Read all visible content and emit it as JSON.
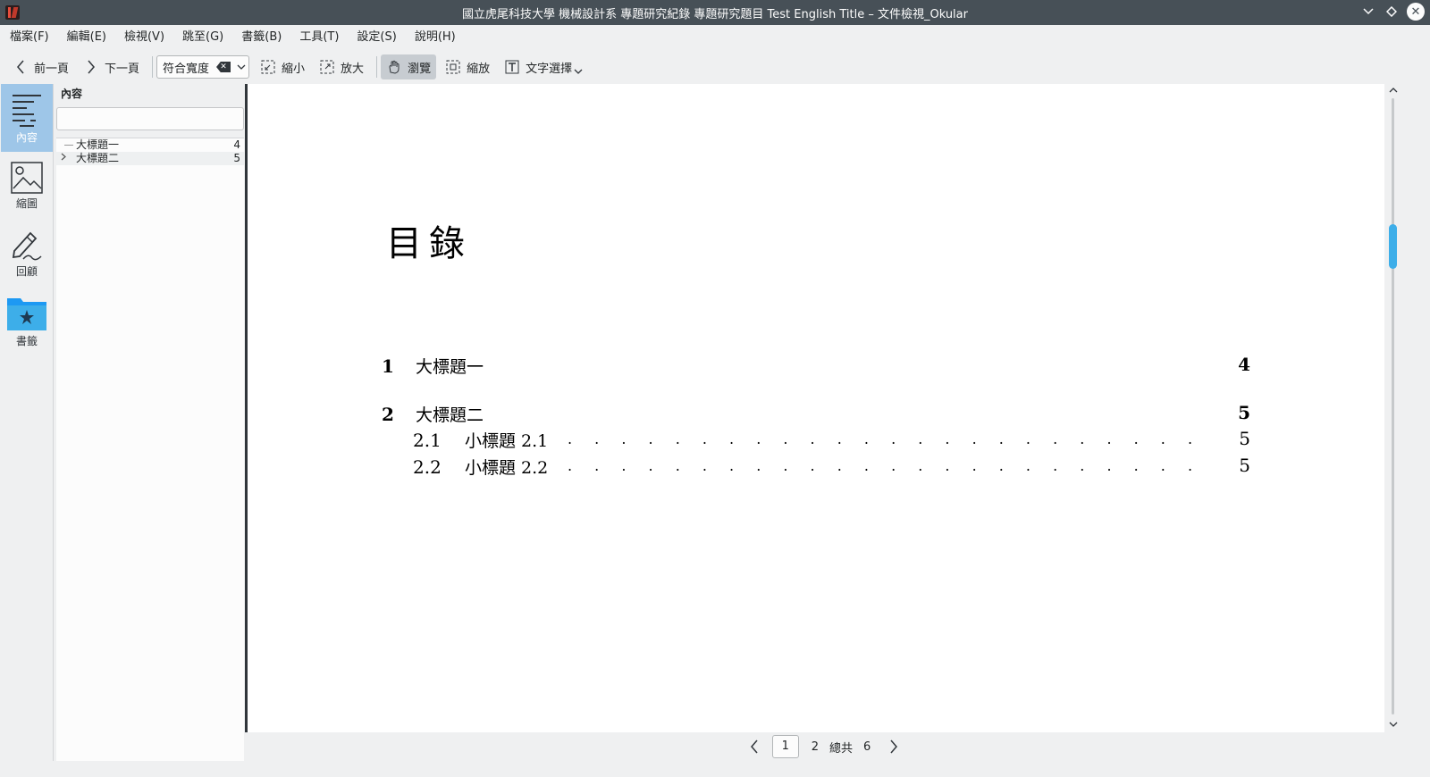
{
  "window": {
    "title": "國立虎尾科技大學 機械設計系 專題研究紀錄 專題研究題目 Test English Title – 文件檢視_Okular"
  },
  "menu": [
    "檔案(F)",
    "編輯(E)",
    "檢視(V)",
    "跳至(G)",
    "書籤(B)",
    "工具(T)",
    "設定(S)",
    "說明(H)"
  ],
  "toolbar": {
    "prev_page": "前一頁",
    "next_page": "下一頁",
    "zoom_value": "符合寬度",
    "zoom_out": "縮小",
    "zoom_in": "放大",
    "browse": "瀏覽",
    "zoom_tool": "縮放",
    "text_select": "文字選擇"
  },
  "sidebar": {
    "items": [
      {
        "label": "內容",
        "icon": "contents-icon",
        "active": true
      },
      {
        "label": "縮圖",
        "icon": "thumbnails-icon",
        "active": false
      },
      {
        "label": "回顧",
        "icon": "review-icon",
        "active": false
      },
      {
        "label": "書籤",
        "icon": "bookmarks-folder-icon",
        "active": false
      }
    ]
  },
  "panel": {
    "title": "內容",
    "search_placeholder": "",
    "toc": [
      {
        "label": "大標題一",
        "page": "4",
        "expandable": false
      },
      {
        "label": "大標題二",
        "page": "5",
        "expandable": true
      }
    ]
  },
  "document": {
    "heading": "目錄",
    "entries": [
      {
        "num": "1",
        "text": "大標題一",
        "page": "4",
        "level": 1
      },
      {
        "num": "2",
        "text": "大標題二",
        "page": "5",
        "level": 1
      },
      {
        "num": "2.1",
        "text": "小標題 2.1",
        "page": "5",
        "level": 2
      },
      {
        "num": "2.2",
        "text": "小標題 2.2",
        "page": "5",
        "level": 2
      }
    ],
    "dots": ". . . . . . . . . . . . . . . . . . . . . . . . . . . . . . . . . . . . . . ."
  },
  "scroll": {
    "position_fraction": 0.22
  },
  "pagination": {
    "current_page": "1",
    "next_page_number": "2",
    "total_label": "總共",
    "total_pages": "6"
  },
  "colors": {
    "accent": "#3daee9",
    "titlebar": "#475057",
    "sidebar_active": "#9ec6e8"
  }
}
